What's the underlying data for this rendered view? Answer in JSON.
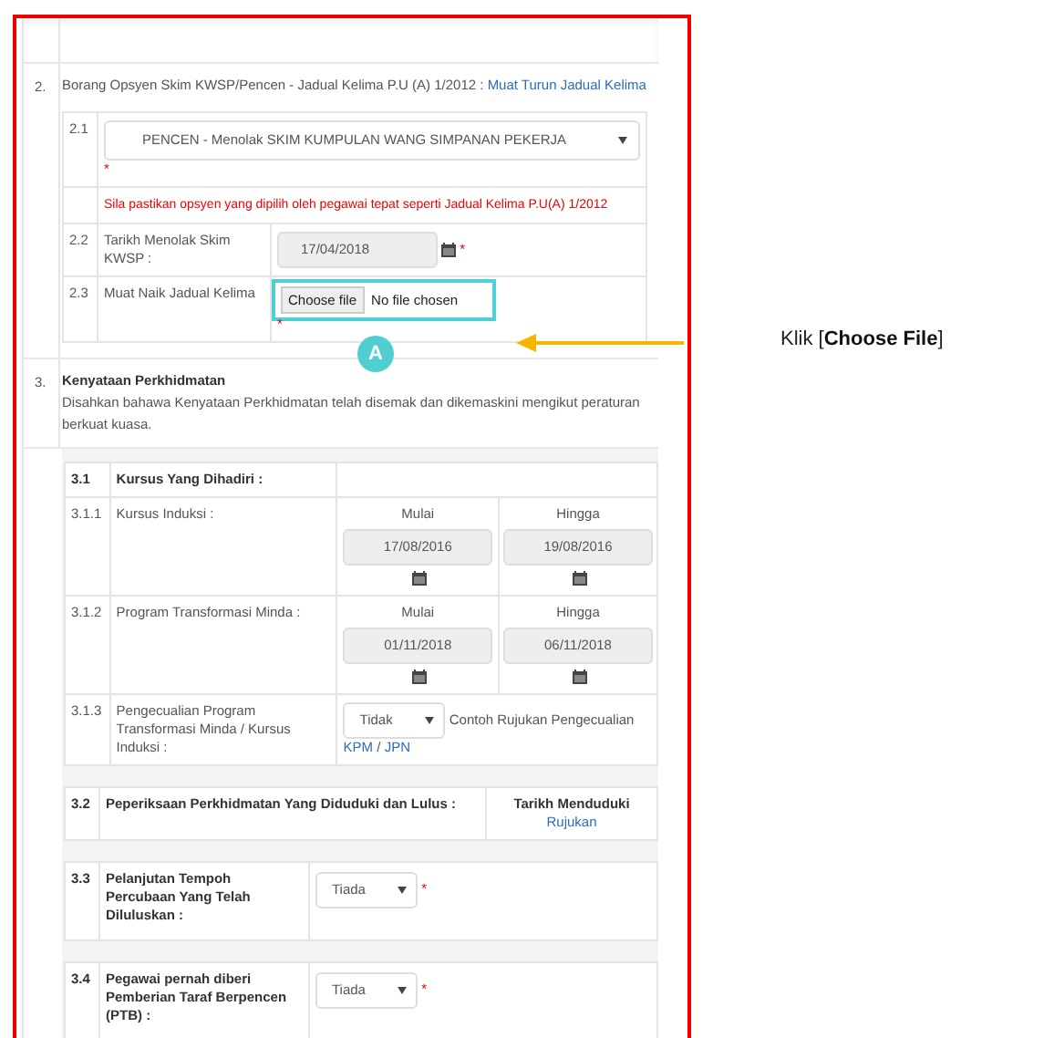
{
  "section2": {
    "number": "2.",
    "text": "Borang Opsyen Skim KWSP/Pencen - Jadual Kelima P.U (A) 1/2012 : ",
    "link": "Muat Turun Jadual Kelima",
    "rows": [
      {
        "kind": "select",
        "number": "2.1",
        "value": "PENCEN - Menolak SKIM KUMPULAN WANG SIMPANAN PEKERJA",
        "mark": "*"
      },
      {
        "kind": "note",
        "text": "Sila pastikan opsyen yang dipilih oleh pegawai tepat seperti Jadual Kelima P.U(A) 1/2012"
      },
      {
        "kind": "date",
        "number": "2.2",
        "label": "Tarikh Menolak Skim KWSP :",
        "value": "17/04/2018",
        "mark": "*"
      },
      {
        "kind": "file",
        "number": "2.3",
        "label": "Muat Naik Jadual Kelima",
        "button": "Choose file",
        "status": "No file chosen",
        "mark": "*",
        "highlighted": true
      }
    ]
  },
  "section3": {
    "number": "3.",
    "title": "Kenyataan Perkhidmatan",
    "description": "Disahkan bahawa Kenyataan Perkhidmatan telah disemak dan dikemaskini mengikut peraturan berkuat kuasa.",
    "courses": {
      "number": "3.1",
      "title": "Kursus Yang Dihadiri :",
      "rows": [
        {
          "kind": "dates",
          "number": "3.1.1",
          "label": "Kursus Induksi :",
          "start_label": "Mulai",
          "start": "17/08/2016",
          "end_label": "Hingga",
          "end": "19/08/2016"
        },
        {
          "kind": "dates",
          "number": "3.1.2",
          "label": "Program Transformasi Minda :",
          "start_label": "Mulai",
          "start": "01/11/2018",
          "end_label": "Hingga",
          "end": "06/11/2018"
        },
        {
          "kind": "exemption",
          "number": "3.1.3",
          "label": "Pengecualian Program Transformasi Minda / Kursus Induksi :",
          "value": "Tidak",
          "text": "Contoh Rujukan Pengecualian",
          "links": [
            "KPM",
            "JPN"
          ],
          "separator": "/"
        }
      ]
    },
    "exams": {
      "number": "3.2",
      "label": "Peperiksaan Perkhidmatan Yang Diduduki dan Lulus :",
      "column": "Tarikh Menduduki",
      "link": "Rujukan"
    },
    "questions": [
      {
        "number": "3.3",
        "label": "Pelanjutan Tempoh Percubaan Yang Telah Diluluskan :",
        "value": "Tiada",
        "mark": "*"
      },
      {
        "number": "3.4",
        "label": "Pegawai pernah diberi Pemberian Taraf Berpencen (PTB) :",
        "value": "Tiada",
        "mark": "*"
      }
    ]
  },
  "callout": {
    "marker": "A",
    "label": "Klik [**Choose File**]"
  }
}
